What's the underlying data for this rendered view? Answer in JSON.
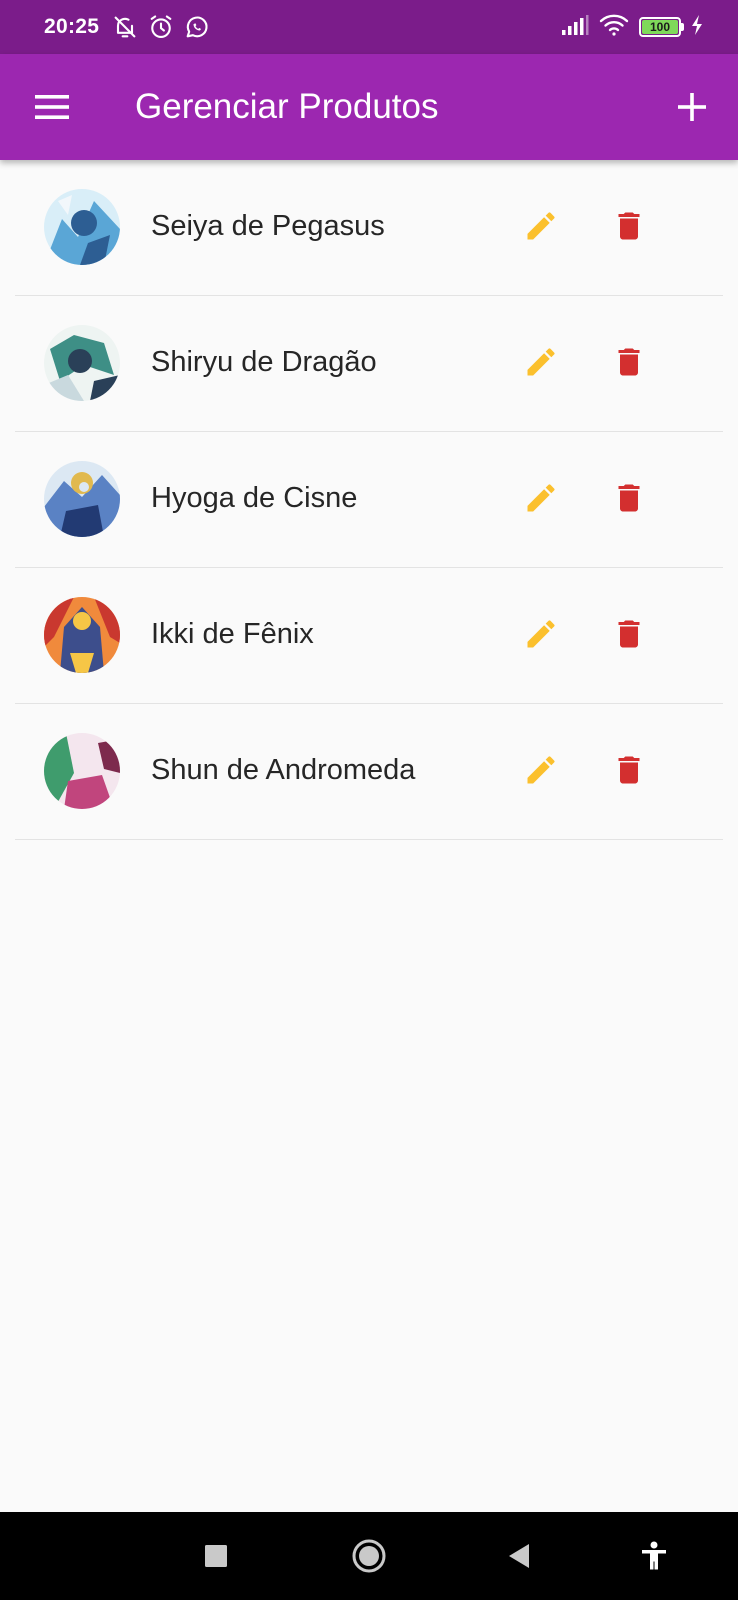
{
  "status_bar": {
    "time": "20:25",
    "left_icons": [
      "mute-bell-icon",
      "alarm-icon",
      "whatsapp-icon"
    ],
    "right_icons": [
      "signal-icon",
      "wifi-icon",
      "battery-icon",
      "charging-icon"
    ],
    "battery_level": "100",
    "color": "#7b1c8a"
  },
  "app_bar": {
    "title": "Gerenciar Produtos",
    "menu_icon": "menu-icon",
    "add_icon": "add-icon",
    "color": "#9c27b0"
  },
  "products": [
    {
      "name": "Seiya de Pegasus",
      "avatar_palette": [
        "#d9eef8",
        "#5aa6d6",
        "#2d5e93",
        "#f2f7fb"
      ]
    },
    {
      "name": "Shiryu de Dragão",
      "avatar_palette": [
        "#eef4f2",
        "#3e8f86",
        "#2a4058",
        "#c9d9de"
      ]
    },
    {
      "name": "Hyoga de Cisne",
      "avatar_palette": [
        "#dce8f3",
        "#5a82c4",
        "#e1b94e",
        "#223a73"
      ]
    },
    {
      "name": "Ikki de Fênix",
      "avatar_palette": [
        "#f08a3c",
        "#3d4e8c",
        "#c9382f",
        "#f6c646"
      ]
    },
    {
      "name": "Shun de Andromeda",
      "avatar_palette": [
        "#f4e6ee",
        "#3f9c6d",
        "#c1457d",
        "#7d2a4d"
      ]
    }
  ],
  "actions": {
    "edit_icon": "edit-icon",
    "edit_color": "#fbc02d",
    "delete_icon": "delete-icon",
    "delete_color": "#d32f2f"
  },
  "nav_bar": {
    "buttons": [
      "recents-icon",
      "home-icon",
      "back-icon",
      "accessibility-icon"
    ]
  }
}
